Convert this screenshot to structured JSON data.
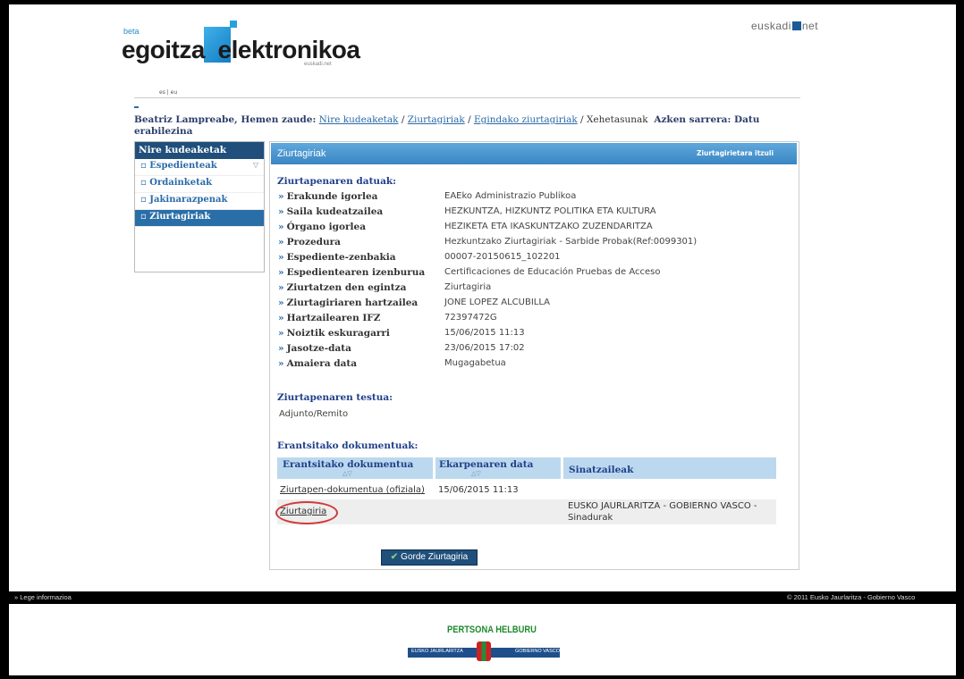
{
  "header": {
    "logo_beta": "beta",
    "logo_text": "egoitza  elektronikoa",
    "logo_sub": "euskadi.net",
    "portal_left": "euskadi",
    "portal_right": "net",
    "langs": "es | eu"
  },
  "breadcrumb": {
    "user": "Beatriz Lampreabe, Hemen zaude:",
    "items": [
      "Nire kudeaketak",
      "Ziurtagiriak",
      "Egindako ziurtagiriak"
    ],
    "current": "Xehetasunak",
    "last_access_label": "Azken sarrera: Datu erabilezina"
  },
  "sidebar": {
    "title": "Nire kudeaketak",
    "items": [
      {
        "label": "Espedienteak"
      },
      {
        "label": "Ordainketak"
      },
      {
        "label": "Jakinarazpenak"
      },
      {
        "label": "Ziurtagiriak"
      }
    ]
  },
  "main": {
    "title": "Ziurtagiriak",
    "back_link": "Ziurtagirietara itzuli",
    "data_section": "Ziurtapenaren datuak:",
    "fields": [
      {
        "label": "Erakunde igorlea",
        "value": "EAEko Administrazio Publikoa"
      },
      {
        "label": "Saila kudeatzailea",
        "value": "HEZKUNTZA, HIZKUNTZ POLITIKA ETA KULTURA"
      },
      {
        "label": "Órgano igorlea",
        "value": "HEZIKETA ETA IKASKUNTZAKO ZUZENDARITZA"
      },
      {
        "label": "Prozedura",
        "value": "Hezkuntzako Ziurtagiriak - Sarbide Probak(Ref:0099301)"
      },
      {
        "label": "Espediente-zenbakia",
        "value": "00007-20150615_102201"
      },
      {
        "label": "Espedientearen izenburua",
        "value": "Certificaciones de Educación Pruebas de Acceso"
      },
      {
        "label": "Ziurtatzen den egintza",
        "value": "Ziurtagiria"
      },
      {
        "label": "Ziurtagiriaren hartzailea",
        "value": "JONE LOPEZ ALCUBILLA"
      },
      {
        "label": "Hartzailearen IFZ",
        "value": "72397472G"
      },
      {
        "label": "Noiztik eskuragarri",
        "value": "15/06/2015 11:13"
      },
      {
        "label": "Jasotze-data",
        "value": "23/06/2015 17:02"
      },
      {
        "label": "Amaiera data",
        "value": "Mugagabetua"
      }
    ],
    "text_section": "Ziurtapenaren testua:",
    "text_value": "Adjunto/Remito",
    "docs_section": "Erantsitako dokumentuak:",
    "docs_headers": [
      "Erantsitako dokumentua",
      "Ekarpenaren data",
      "Sinatzaileak"
    ],
    "sort_glyph": "△▽",
    "docs_rows": [
      {
        "doc": "Ziurtapen-dokumentua (ofiziala)",
        "date": "15/06/2015 11:13",
        "signer": "",
        "signer_link": ""
      },
      {
        "doc": "Ziurtagiria",
        "date": "",
        "signer": "EUSKO JAURLARITZA - GOBIERNO VASCO -",
        "signer_link": "Sinadurak"
      }
    ],
    "save_button": "Gorde Ziurtagiria"
  },
  "footer": {
    "left": "» Lege informazioa",
    "right": "© 2011 Eusko Jaurlaritza - Gobierno Vasco",
    "slogan": "PERTSONA HELBURU",
    "gov_left": "EUSKO JAURLARITZA",
    "gov_right": "GOBIERNO VASCO"
  }
}
